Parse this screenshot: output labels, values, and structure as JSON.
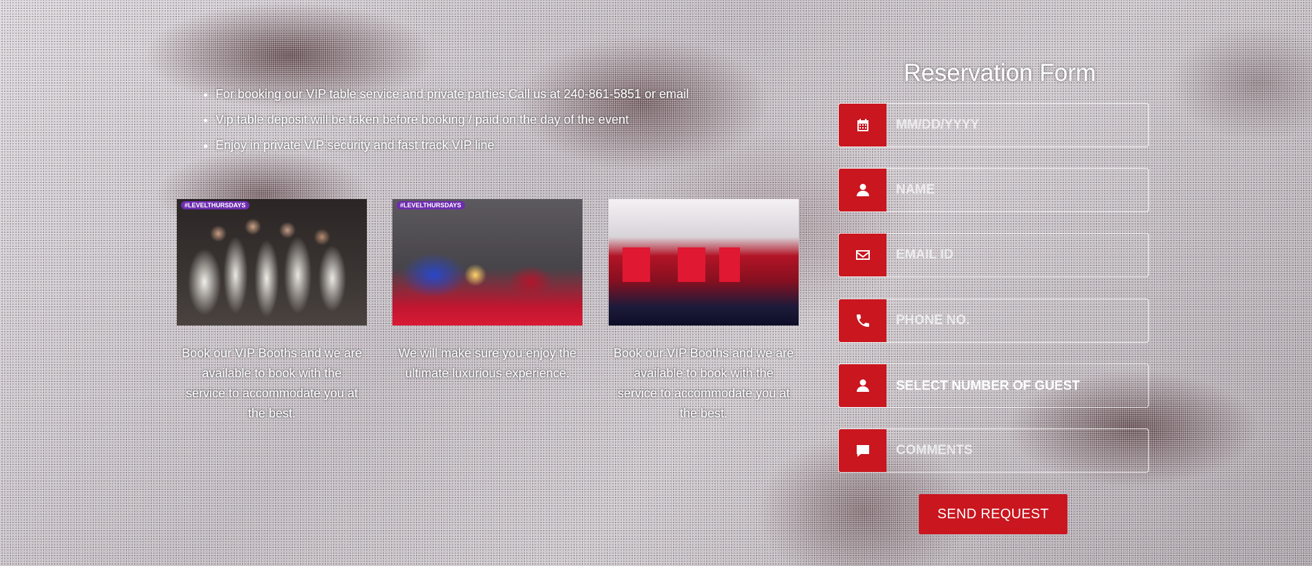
{
  "bullets": [
    "For booking our VIP table service and private parties Call us at 240-861-5851 or email",
    "Vip table deposit will be taken before booking / paid on the day of the event",
    "Enjoy in private VIP security and fast track VIP line"
  ],
  "cards": [
    {
      "tag": "#LEVELTHURSDAYS",
      "text": "Book our VIP Booths and we are available to book with the service to accommodate you at the best."
    },
    {
      "tag": "#LEVELTHURSDAYS",
      "text": "We will make sure you enjoy the ultimate luxurious experience."
    },
    {
      "tag": "",
      "text": "Book our VIP Booths and we are available to book with the service to accommodate you at the best."
    }
  ],
  "form": {
    "title": "Reservation Form",
    "date_placeholder": "MM/DD/YYYY",
    "name_placeholder": "NAME",
    "email_placeholder": "EMAIL ID",
    "phone_placeholder": "PHONE NO.",
    "guests_placeholder": "SELECT NUMBER OF GUEST",
    "comments_placeholder": "COMMENTS",
    "submit_label": "SEND REQUEST"
  },
  "icons": {
    "date": "calendar-icon",
    "name": "user-icon",
    "email": "envelope-icon",
    "phone": "phone-icon",
    "guests": "user-icon",
    "comments": "comment-icon"
  },
  "colors": {
    "accent": "#c9161f",
    "text": "#ffffff"
  }
}
